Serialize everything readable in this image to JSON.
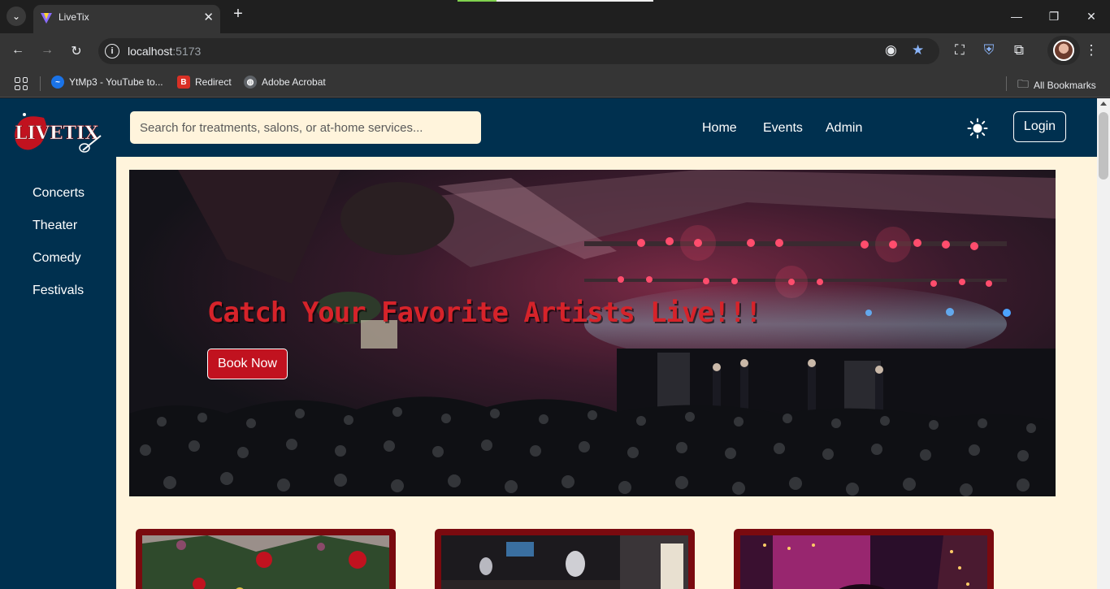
{
  "browser": {
    "tab_title": "LiveTix",
    "url_host": "localhost",
    "url_port": ":5173",
    "bookmarks": [
      {
        "label": "YtMp3 - YouTube to...",
        "icon": "ytmp3-icon",
        "color": "#1a73e8"
      },
      {
        "label": "Redirect",
        "icon": "redirect-icon",
        "color": "#d93025"
      },
      {
        "label": "Adobe Acrobat",
        "icon": "globe-icon",
        "color": "#5f6368"
      }
    ],
    "all_bookmarks": "All Bookmarks"
  },
  "site": {
    "brand": "LIVETIX",
    "search_placeholder": "Search for treatments, salons, or at-home services...",
    "nav": [
      "Home",
      "Events",
      "Admin"
    ],
    "login_label": "Login",
    "sidebar": [
      "Concerts",
      "Theater",
      "Comedy",
      "Festivals"
    ],
    "hero_title": "Catch Your Favorite Artists Live!!!",
    "hero_button": "Book Now",
    "colors": {
      "navy": "#00304f",
      "cream": "#fff4dc",
      "accent_red": "#c1121f",
      "card_border": "#7a0a0f"
    }
  }
}
